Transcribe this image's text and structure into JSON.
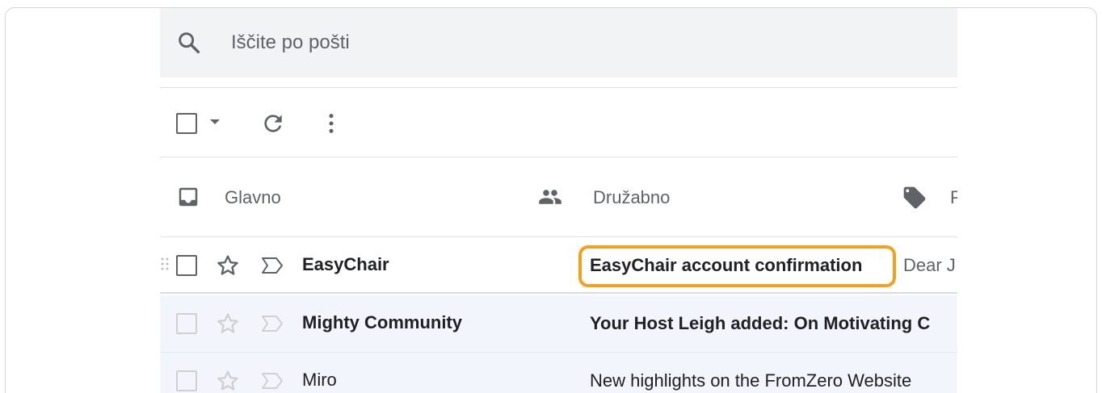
{
  "search": {
    "placeholder": "Iščite po pošti"
  },
  "tabs": [
    {
      "label": "Glavno",
      "icon": "inbox-icon"
    },
    {
      "label": "Družabno",
      "icon": "people-icon"
    },
    {
      "label": "P",
      "icon": "tag-icon"
    }
  ],
  "emails": [
    {
      "sender": "EasyChair",
      "subject": "EasyChair account confirmation",
      "snippet": "Dear J"
    },
    {
      "sender": "Mighty Community",
      "subject": "Your Host Leigh added: On Motivating C",
      "snippet": ""
    },
    {
      "sender": "Miro",
      "subject": "New highlights on the FromZero Website",
      "snippet": ""
    }
  ],
  "colors": {
    "highlight": "#f4a01c",
    "search_bg": "#f1f3f4",
    "icon_gray": "#5f6368"
  }
}
